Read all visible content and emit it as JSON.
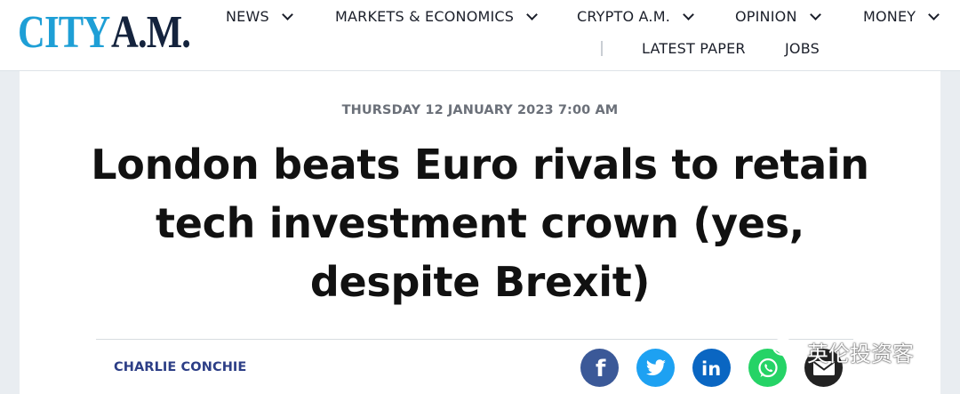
{
  "brand": {
    "city": "CITY",
    "am": "A.M."
  },
  "nav": {
    "row1": [
      {
        "label": "NEWS"
      },
      {
        "label": "MARKETS & ECONOMICS"
      },
      {
        "label": "CRYPTO A.M."
      },
      {
        "label": "OPINION"
      },
      {
        "label": "MONEY"
      }
    ],
    "row2": [
      {
        "label": "LATEST PAPER"
      },
      {
        "label": "JOBS"
      }
    ]
  },
  "article": {
    "dateline": "THURSDAY 12 JANUARY 2023 7:00 AM",
    "headline_line1": "London beats Euro rivals to retain",
    "headline_line2": "tech investment crown (yes,",
    "headline_line3": "despite Brexit)",
    "author": "CHARLIE CONCHIE"
  },
  "share": [
    {
      "icon": "facebook-icon",
      "glyph": "f",
      "color": "#3b5998"
    },
    {
      "icon": "twitter-icon",
      "color": "#1da1f2"
    },
    {
      "icon": "linkedin-icon",
      "glyph": "in",
      "color": "#0a66c2"
    },
    {
      "icon": "whatsapp-icon",
      "color": "#25d366"
    },
    {
      "icon": "email-icon",
      "color": "#222222"
    }
  ],
  "watermark": {
    "text": "英伦投资客"
  },
  "colors": {
    "brand_blue": "#1e9fd6",
    "brand_navy": "#14233d",
    "author": "#2c3e86"
  }
}
